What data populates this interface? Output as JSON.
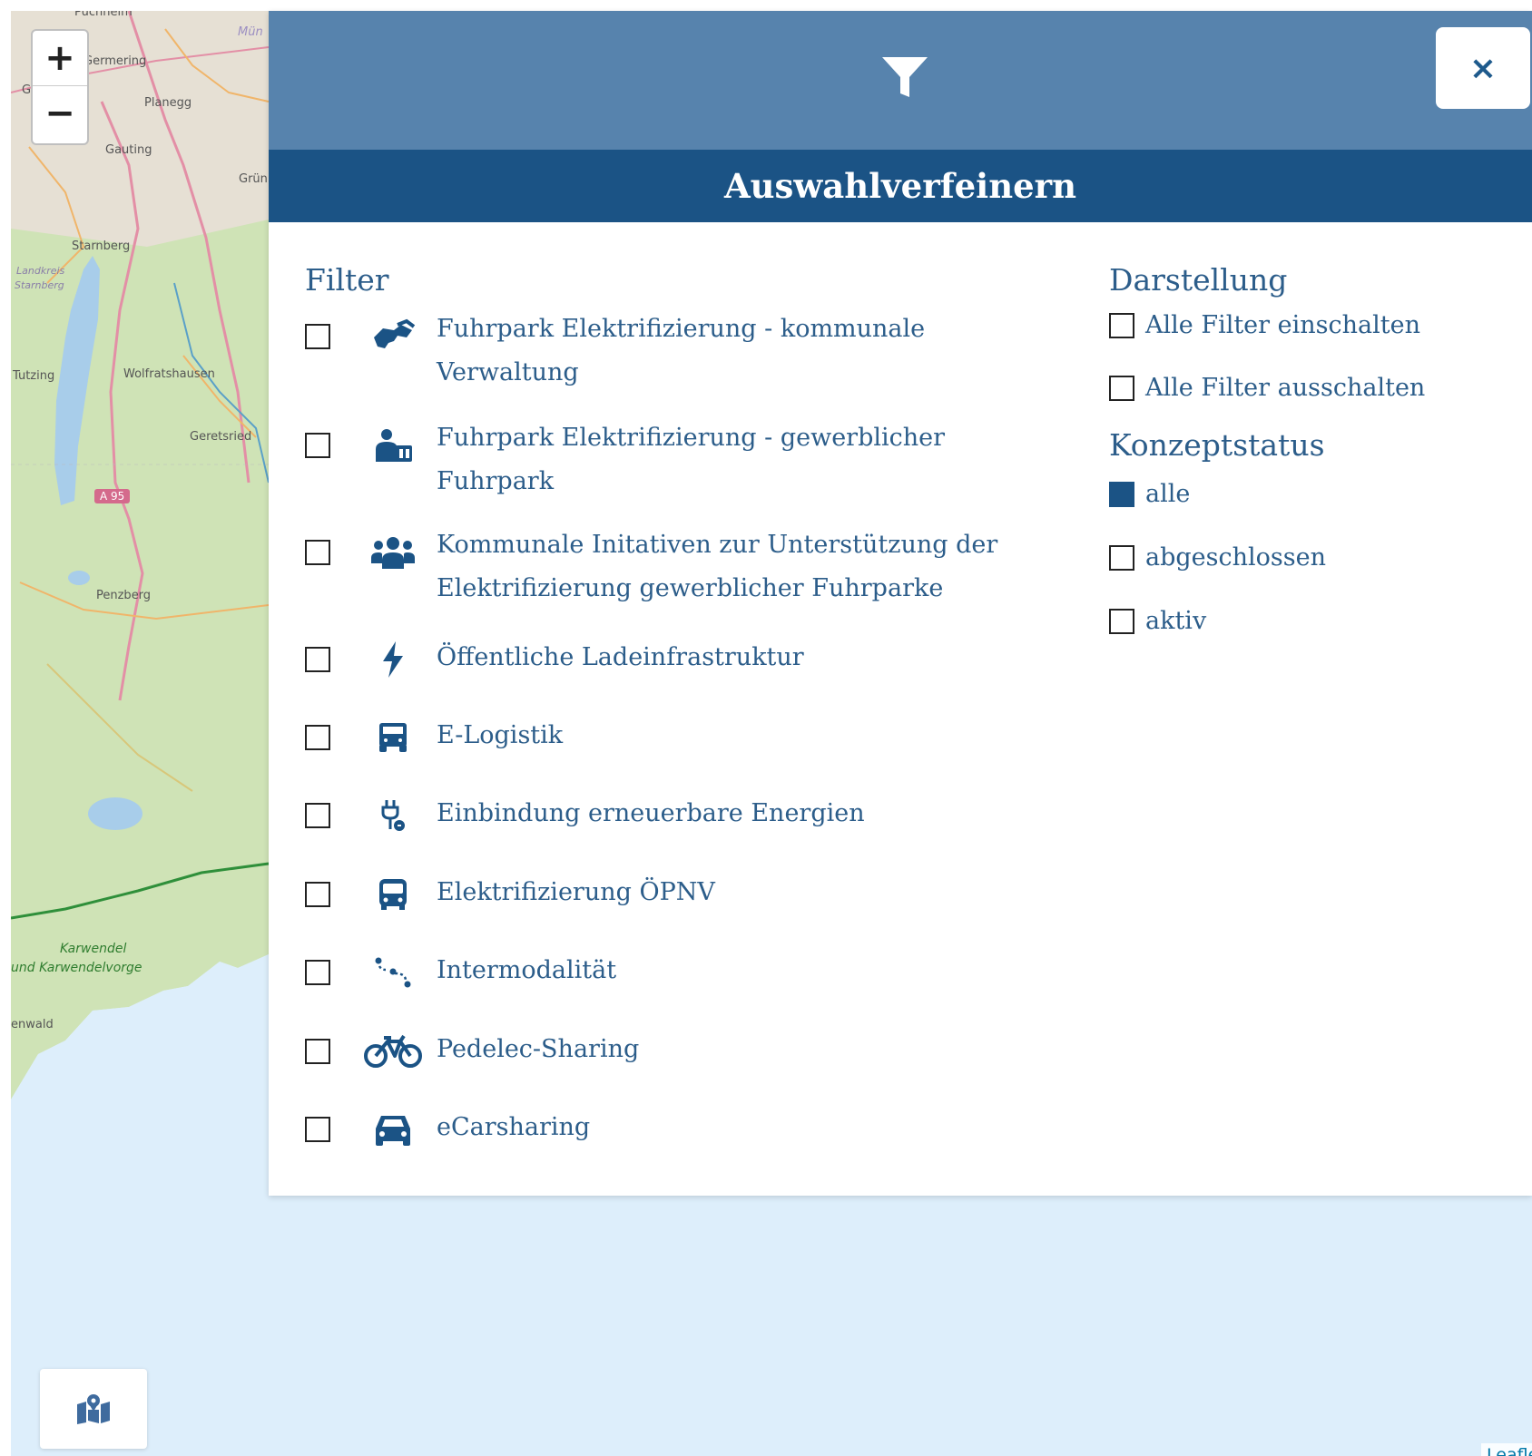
{
  "map": {
    "labels": {
      "puchheim": "Puchheim",
      "germering": "Germering",
      "g": "G",
      "muenchen": "Mün",
      "planegg": "Planegg",
      "gauting": "Gauting",
      "gruenwald": "Grün",
      "starnberg": "Starnberg",
      "lk1": "Landkreis",
      "lk2": "Starnberg",
      "tutzing": "Tutzing",
      "wolfratshausen": "Wolfratshausen",
      "geretsried": "Geretsried",
      "penzberg": "Penzberg",
      "karwendel1": "Karwendel",
      "karwendel2": "und Karwendelvorge",
      "wald": "enwald"
    },
    "road_shield": "A 95",
    "zoom_in": "+",
    "zoom_out": "−",
    "layer_icon": "map-marked-icon",
    "attribution": "Leaflet"
  },
  "panel": {
    "header_icon": "funnel-icon",
    "close_label": "×",
    "title": "Auswahlverfeinern",
    "filter_title": "Filter",
    "filters": [
      {
        "line1": "Fuhrpark Elektrifizierung - kommunale",
        "line2": "Verwaltung",
        "icon": "handshake-icon",
        "checked": false
      },
      {
        "line1": "Fuhrpark Elektrifizierung - gewerblicher",
        "line2": "Fuhrpark",
        "icon": "business-fleet-icon",
        "checked": false
      },
      {
        "line1": "Kommunale Initativen zur Unterstützung der",
        "line2": "Elektrifizierung gewerblicher Fuhrparke",
        "icon": "users-icon",
        "checked": false
      },
      {
        "line1": "Öffentliche Ladeinfrastruktur",
        "line2": "",
        "icon": "bolt-icon",
        "checked": false
      },
      {
        "line1": "E-Logistik",
        "line2": "",
        "icon": "truck-icon",
        "checked": false
      },
      {
        "line1": "Einbindung erneuerbare Energien",
        "line2": "",
        "icon": "charging-icon",
        "checked": false
      },
      {
        "line1": "Elektrifizierung ÖPNV",
        "line2": "",
        "icon": "bus-icon",
        "checked": false
      },
      {
        "line1": "Intermodalität",
        "line2": "",
        "icon": "route-icon",
        "checked": false
      },
      {
        "line1": "Pedelec-Sharing",
        "line2": "",
        "icon": "bicycle-icon",
        "checked": false
      },
      {
        "line1": "eCarsharing",
        "line2": "",
        "icon": "car-icon",
        "checked": false
      }
    ],
    "display_title": "Darstellung",
    "display_options": [
      {
        "label": "Alle Filter einschalten",
        "checked": false
      },
      {
        "label": "Alle Filter ausschalten",
        "checked": false
      }
    ],
    "status_title": "Konzeptstatus",
    "status_options": [
      {
        "label": "alle",
        "checked": true
      },
      {
        "label": "abgeschlossen",
        "checked": false
      },
      {
        "label": "aktiv",
        "checked": false
      }
    ]
  },
  "colors": {
    "header": "#5783ad",
    "title_bar": "#1b5385",
    "text": "#2c5d8a",
    "map_water": "#ddeefb"
  }
}
